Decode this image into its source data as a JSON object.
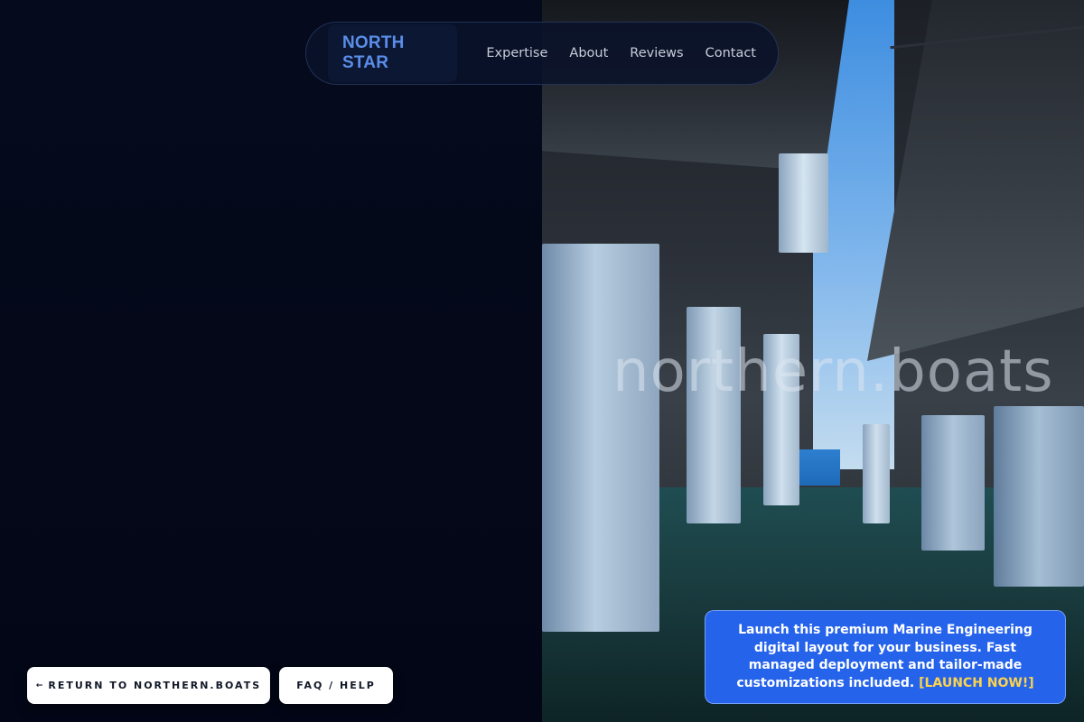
{
  "nav": {
    "logo": "NORTH STAR",
    "links": [
      {
        "label": "Expertise"
      },
      {
        "label": "About"
      },
      {
        "label": "Reviews"
      },
      {
        "label": "Contact"
      }
    ]
  },
  "hero": {
    "watermark": "northern.boats"
  },
  "footer_buttons": {
    "return_arrow": "←",
    "return_label": "RETURN TO NORTHERN.BOATS",
    "faq_label": "FAQ / HELP"
  },
  "promo": {
    "text": "Launch this premium Marine Engineering digital layout for your business. Fast managed deployment and tailor-made customizations included.",
    "cta": "[LAUNCH NOW!]"
  },
  "colors": {
    "background": "#050a1c",
    "logo_accent": "#5a8ee8",
    "promo_background": "#2563eb",
    "promo_cta": "#fcd34d"
  }
}
